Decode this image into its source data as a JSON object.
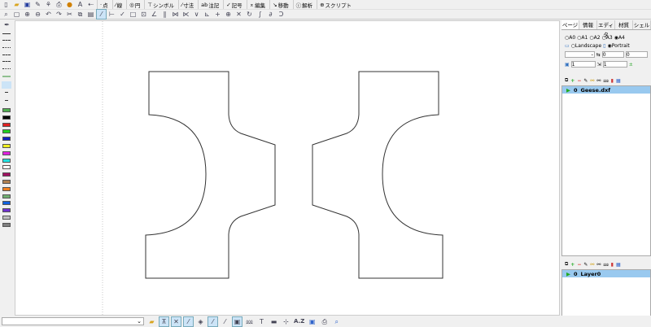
{
  "toolbar": {
    "menus": [
      "点",
      "線",
      "円",
      "シンボル",
      "寸法",
      "注記",
      "記号",
      "編集",
      "移動",
      "解析",
      "スクリプト"
    ]
  },
  "palette": {
    "colors": [
      "#50b050",
      "#000000",
      "#e02020",
      "#20d020",
      "#1020c0",
      "#f0f020",
      "#e020e0",
      "#20e0e0",
      "#ffffff",
      "#a01060",
      "#b08050",
      "#f08020",
      "#70b070",
      "#1060e0",
      "#7030d0",
      "#c0c0c0",
      "#808080"
    ]
  },
  "panel": {
    "tabs": [
      "ページ",
      "情報",
      "エディタ",
      "材質",
      "シェル"
    ],
    "sizes": [
      "A0",
      "A1",
      "A2",
      "A3",
      "A4"
    ],
    "selected_size": "A4",
    "orientation": {
      "landscape": "Landscape",
      "portrait": "Portrait",
      "selected": "Portrait"
    },
    "offset_x": "0",
    "offset_y": "0",
    "scale1": "1",
    "scale2": "1",
    "files": [
      {
        "index": "0",
        "name": "Geese.dxf"
      }
    ],
    "layers": [
      {
        "index": "0",
        "name": "Layer0"
      }
    ]
  },
  "status": {
    "command": "",
    "az_label": "A.Z"
  }
}
